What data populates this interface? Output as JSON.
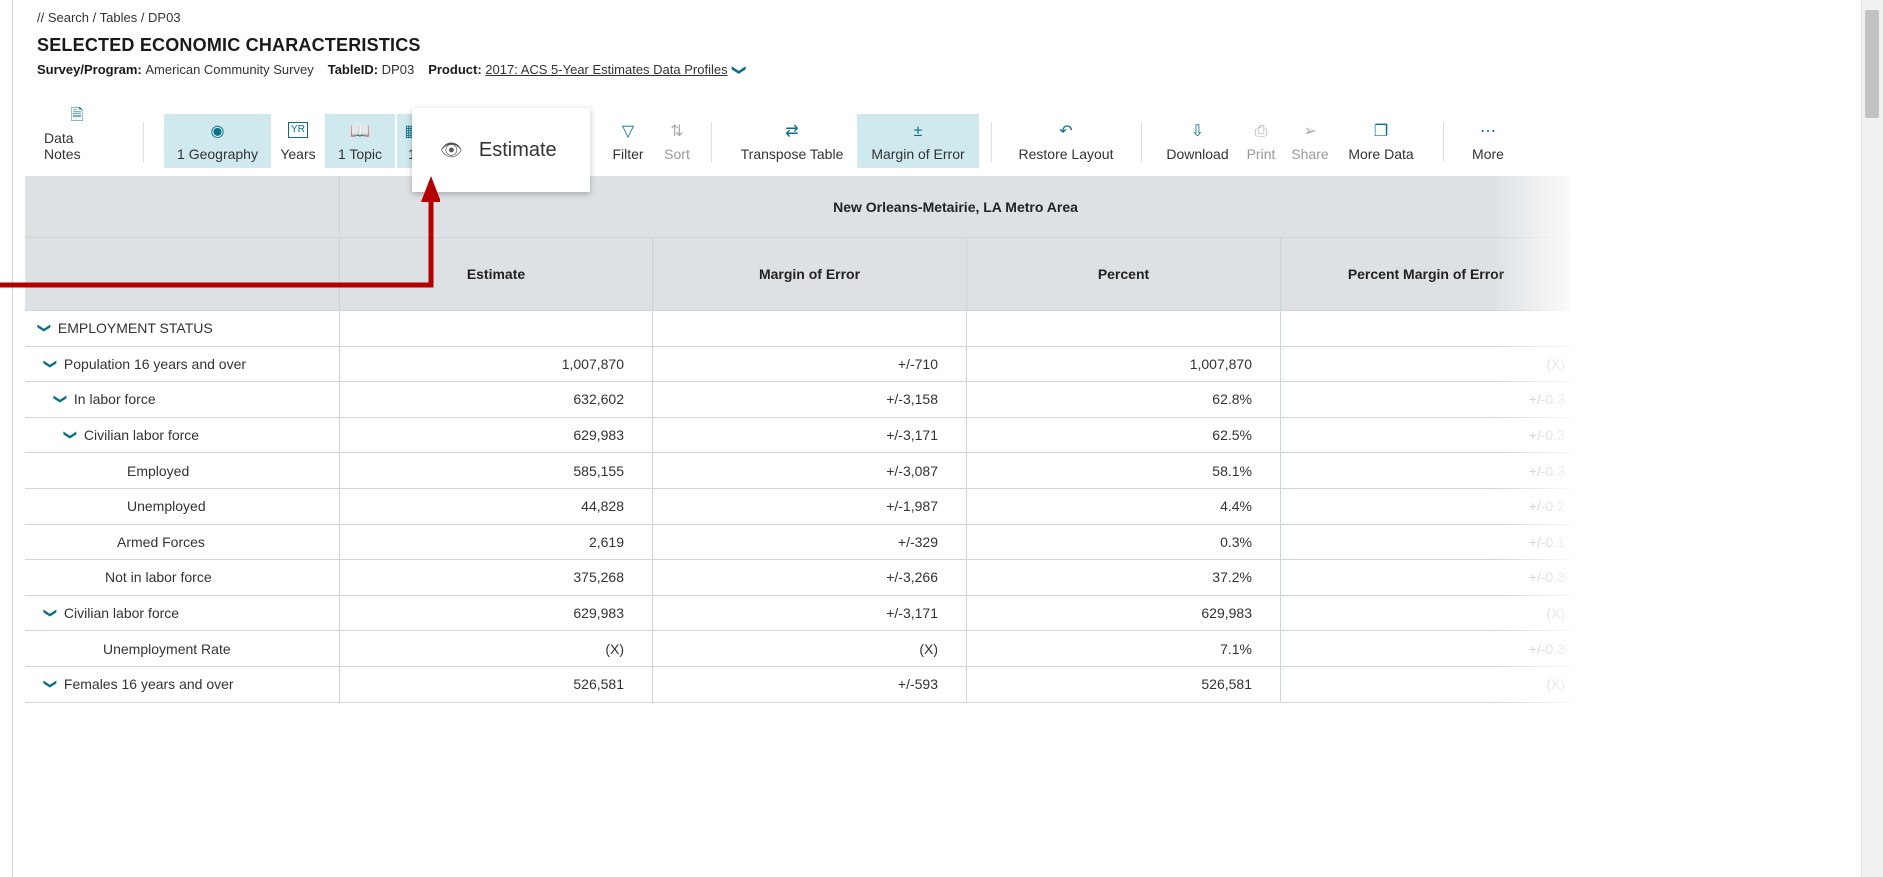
{
  "breadcrumb": "// Search / Tables / DP03",
  "title": "SELECTED ECONOMIC CHARACTERISTICS",
  "meta": {
    "survey_label": "Survey/Program:",
    "survey_value": "American Community Survey",
    "tableid_label": "TableID:",
    "tableid_value": "DP03",
    "product_label": "Product:",
    "product_value": "2017: ACS 5-Year Estimates Data Profiles"
  },
  "toolbar": {
    "data_notes": "Data Notes",
    "geography": "1 Geography",
    "years": "Years",
    "topic": "1 Topic",
    "topic2": "1",
    "filter": "Filter",
    "sort": "Sort",
    "transpose": "Transpose Table",
    "margin": "Margin of Error",
    "restore": "Restore Layout",
    "download": "Download",
    "print": "Print",
    "share": "Share",
    "more_data": "More Data",
    "more": "More",
    "years_icon_text": "YR"
  },
  "popup": {
    "label": "Estimate"
  },
  "table": {
    "geography": "New Orleans-Metairie, LA Metro Area",
    "columns": [
      "Estimate",
      "Margin of Error",
      "Percent",
      "Percent Margin of Error"
    ],
    "rows": [
      {
        "label": "EMPLOYMENT STATUS",
        "v": [
          "",
          "",
          "",
          ""
        ]
      },
      {
        "label": "Population 16 years and over",
        "v": [
          "1,007,870",
          "+/-710",
          "1,007,870",
          "(X)"
        ]
      },
      {
        "label": "In labor force",
        "v": [
          "632,602",
          "+/-3,158",
          "62.8%",
          "+/-0.3"
        ]
      },
      {
        "label": "Civilian labor force",
        "v": [
          "629,983",
          "+/-3,171",
          "62.5%",
          "+/-0.3"
        ]
      },
      {
        "label": "Employed",
        "v": [
          "585,155",
          "+/-3,087",
          "58.1%",
          "+/-0.3"
        ]
      },
      {
        "label": "Unemployed",
        "v": [
          "44,828",
          "+/-1,987",
          "4.4%",
          "+/-0.2"
        ]
      },
      {
        "label": "Armed Forces",
        "v": [
          "2,619",
          "+/-329",
          "0.3%",
          "+/-0.1"
        ]
      },
      {
        "label": "Not in labor force",
        "v": [
          "375,268",
          "+/-3,266",
          "37.2%",
          "+/-0.3"
        ]
      },
      {
        "label": "Civilian labor force",
        "v": [
          "629,983",
          "+/-3,171",
          "629,983",
          "(X)"
        ]
      },
      {
        "label": "Unemployment Rate",
        "v": [
          "(X)",
          "(X)",
          "7.1%",
          "+/-0.3"
        ]
      },
      {
        "label": "Females 16 years and over",
        "v": [
          "526,581",
          "+/-593",
          "526,581",
          "(X)"
        ]
      }
    ]
  },
  "colors": {
    "accent": "#0b6f86",
    "active_bg": "#cfe9ee",
    "header_bg": "#dde1e4",
    "arrow": "#b40000"
  }
}
